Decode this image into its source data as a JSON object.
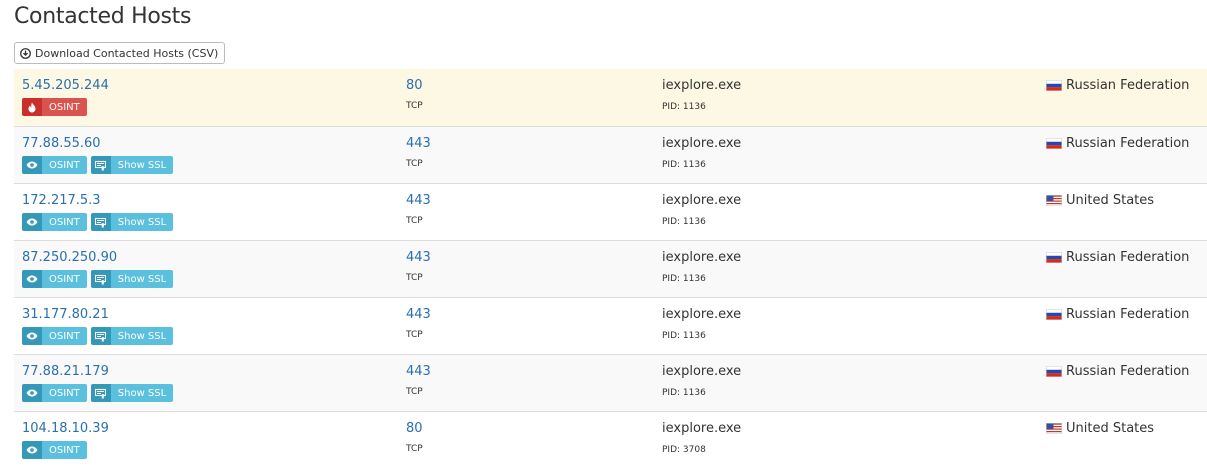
{
  "page": {
    "title": "Contacted Hosts",
    "download_button_label": "Download Contacted Hosts (CSV)"
  },
  "hosts": [
    {
      "ip": "5.45.205.244",
      "port": "80",
      "protocol": "TCP",
      "process": "iexplore.exe",
      "pid": "PID: 1136",
      "country": "Russian Federation",
      "flag": "ru",
      "osint_label": "OSINT",
      "osint_style": "danger",
      "show_ssl": false
    },
    {
      "ip": "77.88.55.60",
      "port": "443",
      "protocol": "TCP",
      "process": "iexplore.exe",
      "pid": "PID: 1136",
      "country": "Russian Federation",
      "flag": "ru",
      "osint_label": "OSINT",
      "osint_style": "info",
      "show_ssl": true,
      "ssl_label": "Show SSL"
    },
    {
      "ip": "172.217.5.3",
      "port": "443",
      "protocol": "TCP",
      "process": "iexplore.exe",
      "pid": "PID: 1136",
      "country": "United States",
      "flag": "us",
      "osint_label": "OSINT",
      "osint_style": "info",
      "show_ssl": true,
      "ssl_label": "Show SSL"
    },
    {
      "ip": "87.250.250.90",
      "port": "443",
      "protocol": "TCP",
      "process": "iexplore.exe",
      "pid": "PID: 1136",
      "country": "Russian Federation",
      "flag": "ru",
      "osint_label": "OSINT",
      "osint_style": "info",
      "show_ssl": true,
      "ssl_label": "Show SSL"
    },
    {
      "ip": "31.177.80.21",
      "port": "443",
      "protocol": "TCP",
      "process": "iexplore.exe",
      "pid": "PID: 1136",
      "country": "Russian Federation",
      "flag": "ru",
      "osint_label": "OSINT",
      "osint_style": "info",
      "show_ssl": true,
      "ssl_label": "Show SSL"
    },
    {
      "ip": "77.88.21.179",
      "port": "443",
      "protocol": "TCP",
      "process": "iexplore.exe",
      "pid": "PID: 1136",
      "country": "Russian Federation",
      "flag": "ru",
      "osint_label": "OSINT",
      "osint_style": "info",
      "show_ssl": true,
      "ssl_label": "Show SSL"
    },
    {
      "ip": "104.18.10.39",
      "port": "80",
      "protocol": "TCP",
      "process": "iexplore.exe",
      "pid": "PID: 3708",
      "country": "United States",
      "flag": "us",
      "osint_label": "OSINT",
      "osint_style": "info",
      "show_ssl": false
    }
  ],
  "icons": {
    "download": "download-circle-icon",
    "osint_danger": "fire-icon",
    "osint_info": "eye-icon",
    "ssl": "certificate-icon"
  }
}
